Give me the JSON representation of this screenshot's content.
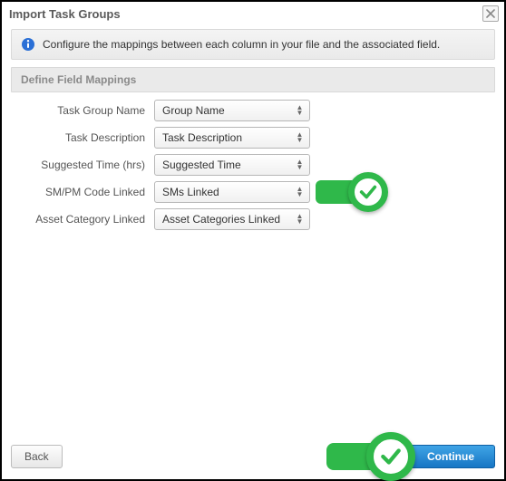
{
  "dialog": {
    "title": "Import Task Groups",
    "info_text": "Configure the mappings between each column in your file and the associated field.",
    "section_title": "Define Field Mappings"
  },
  "fields": [
    {
      "label": "Task Group Name",
      "value": "Group Name"
    },
    {
      "label": "Task Description",
      "value": "Task Description"
    },
    {
      "label": "Suggested Time (hrs)",
      "value": "Suggested Time"
    },
    {
      "label": "SM/PM Code Linked",
      "value": "SMs Linked"
    },
    {
      "label": "Asset Category Linked",
      "value": "Asset Categories Linked"
    }
  ],
  "buttons": {
    "back": "Back",
    "continue": "Continue"
  }
}
